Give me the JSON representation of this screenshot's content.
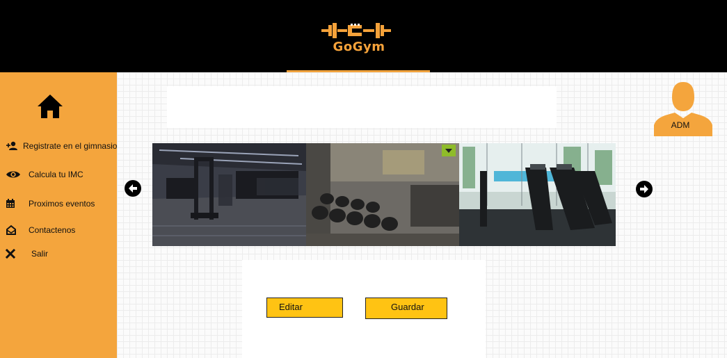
{
  "brand": {
    "name": "GoGym",
    "color": "#f5a23a"
  },
  "sidebar": {
    "items": [
      {
        "label": "Registrate en el gimnasio",
        "icon": "add-user-icon"
      },
      {
        "label": "Calcula tu IMC",
        "icon": "eye-icon"
      },
      {
        "label": "Proximos eventos",
        "icon": "calendar-icon"
      },
      {
        "label": "Contactenos",
        "icon": "mail-icon"
      },
      {
        "label": "Salir",
        "icon": "close-icon"
      }
    ]
  },
  "user": {
    "label": "ADM"
  },
  "actions": {
    "edit_label": "Editar",
    "save_label": "Guardar"
  },
  "colors": {
    "sidebar": "#f4a53d",
    "header": "#000000",
    "button": "#ffc313"
  }
}
